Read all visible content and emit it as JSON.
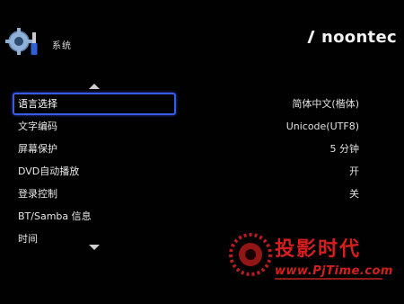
{
  "header": {
    "title": "系统",
    "brand": "noontec"
  },
  "menu": {
    "items": [
      {
        "label": "语言选择",
        "value": "简体中文(楷体)"
      },
      {
        "label": "文字编码",
        "value": "Unicode(UTF8)"
      },
      {
        "label": "屏幕保护",
        "value": "5 分钟"
      },
      {
        "label": "DVD自动播放",
        "value": "开"
      },
      {
        "label": "登录控制",
        "value": "关"
      },
      {
        "label": "BT/Samba 信息",
        "value": ""
      },
      {
        "label": "时间",
        "value": ""
      }
    ],
    "selected_index": 0
  },
  "watermark": {
    "text": "投影时代",
    "url": "www.PjTime.com"
  },
  "colors": {
    "background": "#010101",
    "selection_border": "#3a5be6",
    "watermark": "#d51e1e"
  },
  "icons": {
    "settings": "gear-screwdriver-icon",
    "scroll_up": "triangle-up-icon",
    "scroll_down": "triangle-down-icon"
  }
}
